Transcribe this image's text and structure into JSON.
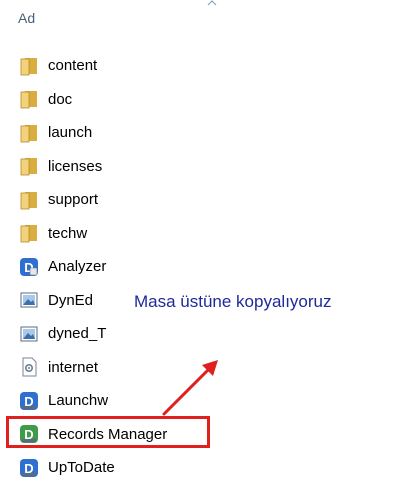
{
  "list": {
    "column_header": "Ad",
    "items": [
      {
        "label": "content",
        "icon": "folder-icon"
      },
      {
        "label": "doc",
        "icon": "folder-icon"
      },
      {
        "label": "launch",
        "icon": "folder-icon"
      },
      {
        "label": "licenses",
        "icon": "folder-icon"
      },
      {
        "label": "support",
        "icon": "folder-icon"
      },
      {
        "label": "techw",
        "icon": "folder-icon"
      },
      {
        "label": "Analyzer",
        "icon": "app-icon"
      },
      {
        "label": "DynEd",
        "icon": "image-file-icon"
      },
      {
        "label": "dyned_T",
        "icon": "image-file-icon"
      },
      {
        "label": "internet",
        "icon": "settings-file-icon"
      },
      {
        "label": "Launchw",
        "icon": "app-icon"
      },
      {
        "label": "Records Manager",
        "icon": "app-icon"
      },
      {
        "label": "UpToDate",
        "icon": "app-icon"
      }
    ]
  },
  "annotation": {
    "text": "Masa üstüne kopyalıyoruz",
    "color": "#1e2a9a",
    "highlight_color": "#e0201e",
    "highlighted_item": "Records Manager"
  },
  "colors": {
    "folder": "#e8c15a",
    "app_blue": "#2f6fd0",
    "app_green": "#3f9a4a"
  }
}
